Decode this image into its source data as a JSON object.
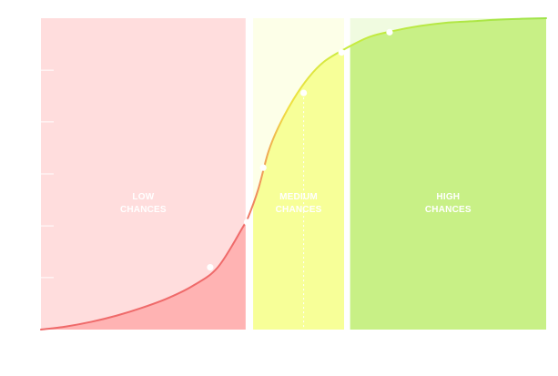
{
  "chart_data": {
    "type": "area",
    "title": "",
    "xlabel": "",
    "ylabel": "",
    "grid": false,
    "legend": "none",
    "xlim": [
      0,
      10
    ],
    "ylim": [
      0,
      1
    ],
    "zones": [
      {
        "name": "low",
        "label_lines": [
          "LOW",
          "CHANCES"
        ],
        "x_start": 0,
        "x_end": 4.05,
        "fill": "#ffdddd",
        "fill_under": "#ffb3b3",
        "line_color": "#ef6a6a"
      },
      {
        "name": "medium",
        "label_lines": [
          "MEDIUM",
          "CHANCES"
        ],
        "x_start": 4.2,
        "x_end": 6.0,
        "fill": "#fdffe8",
        "fill_under": "#f7ff98",
        "line_color": "#d4ee44"
      },
      {
        "name": "high",
        "label_lines": [
          "HIGH",
          "CHANCES"
        ],
        "x_start": 6.12,
        "x_end": 10,
        "fill": "#f0fbe0",
        "fill_under": "#c8f086",
        "line_color": "#9ee34a"
      }
    ],
    "curve": {
      "x": [
        0,
        0.5,
        1,
        1.5,
        2,
        2.5,
        3,
        3.5,
        4,
        4.1,
        4.3,
        4.5,
        4.7,
        5,
        5.3,
        5.6,
        6,
        6.5,
        7,
        7.5,
        8,
        8.5,
        9,
        9.5,
        10
      ],
      "y": [
        0.0,
        0.01,
        0.025,
        0.045,
        0.07,
        0.1,
        0.14,
        0.2,
        0.33,
        0.36,
        0.45,
        0.57,
        0.65,
        0.74,
        0.81,
        0.86,
        0.9,
        0.94,
        0.96,
        0.975,
        0.985,
        0.99,
        0.995,
        0.998,
        1.0
      ]
    },
    "markers": [
      {
        "x": 3.35,
        "y": 0.2
      },
      {
        "x": 4.08,
        "y": 0.345
      },
      {
        "x": 4.4,
        "y": 0.52
      },
      {
        "x": 5.2,
        "y": 0.76
      },
      {
        "x": 5.95,
        "y": 0.89
      },
      {
        "x": 6.9,
        "y": 0.955
      }
    ],
    "guide_x": 5.2,
    "ticks_y": [
      0,
      0.167,
      0.333,
      0.5,
      0.667,
      0.833
    ]
  }
}
